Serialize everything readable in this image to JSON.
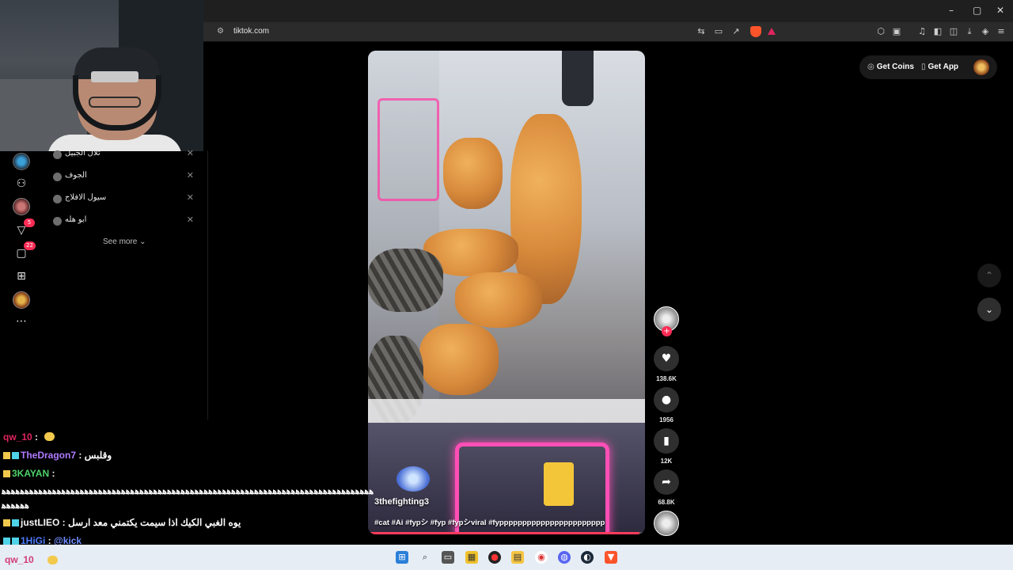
{
  "browser": {
    "url": "tiktok.com",
    "window_controls": [
      "–",
      "▢",
      "✕"
    ]
  },
  "sidebar": {
    "rail_badges": {
      "inbox": "5",
      "messages": "22"
    },
    "recent_searches": [
      "ثلال الجبيل",
      "الجوف",
      "سيول الافلاج",
      "ابو هله"
    ],
    "see_more": "See more"
  },
  "header": {
    "get_coins": "Get Coins",
    "get_app": "Get App"
  },
  "video": {
    "author": "3thefighting3",
    "caption": "#cat #Ai #fypシ #fyp #fypシviral #fyppppppppppppppppppppppp",
    "progress": 0.98
  },
  "actions": {
    "likes": "138.6K",
    "comments": "1956",
    "saves": "12K",
    "shares": "68.8K"
  },
  "chat": {
    "messages": [
      {
        "user": "qw_10",
        "sep": " :",
        "text": "",
        "color": "#e0245e"
      },
      {
        "user": "TheDragon7",
        "sep": " : ",
        "text": "وقلبس",
        "color": "#b07cff"
      },
      {
        "user": "3KAYAN",
        "sep": " :",
        "text": "",
        "color": "#4fd36b"
      },
      {
        "user": "justLIEO",
        "sep": " : ",
        "text": "يوه الغبي الكيك اذا سيمت يكتمني معد ارسل",
        "color": "#f5f5f5"
      },
      {
        "user": "1HiGi",
        "sep": " : ",
        "text": "@kick",
        "color": "#4f7cff"
      }
    ],
    "spam": "ﻫﻫﻫﻫﻫﻫﻫﻫﻫﻫﻫﻫﻫﻫﻫﻫﻫﻫﻫﻫﻫﻫﻫﻫﻫﻫﻫﻫﻫﻫﻫﻫﻫﻫﻫﻫﻫﻫﻫﻫﻫﻫﻫﻫﻫﻫﻫﻫﻫﻫﻫﻫﻫﻫﻫﻫﻫﻫﻫﻫﻫﻫﻫﻫﻫﻫﻫﻫﻫﻫﻫﻫﻫﻫﻫﻫﻫﻫﻫﻫﻫﻫﻫﻫﻫﻫﻫﻫﻫﻫﻫﻫ",
    "spam2": "ﻫﻫﻫﻫﻫﻫ"
  },
  "taskbar": {
    "user": "qw_10"
  },
  "colors": {
    "accent": "#fe2c55",
    "taskbar": "#e6edf4"
  }
}
